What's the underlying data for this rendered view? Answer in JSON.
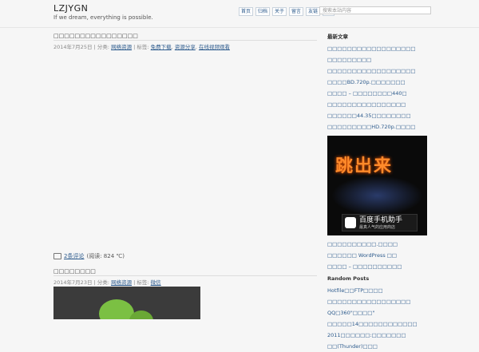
{
  "site": {
    "title": "LZJYGN",
    "tagline": "If we dream, everything is possible."
  },
  "nav": {
    "items": [
      "首页",
      "归档",
      "关于",
      "留言",
      "友链"
    ],
    "search_placeholder": "搜索本站内容"
  },
  "posts": [
    {
      "title": "□□□□□□□□□□□□□□□□",
      "date": "2014年7月25日",
      "cat_label": "分类:",
      "category": "网络资源",
      "tag_label": "标签:",
      "tags": [
        "免费下载",
        "资源分享",
        "在线视频观看"
      ],
      "comments": "2条评论",
      "views": "(阅读: 824 ℃)"
    },
    {
      "title": "□□□□□□□□",
      "date": "2014年7月23日",
      "cat_label": "分类:",
      "category": "网络资源",
      "tag_label": "标签:",
      "tags": [
        "微信"
      ]
    }
  ],
  "sidebar": {
    "recent_heading": "最新文章",
    "recent": [
      "□□□□□□□□□□□□□□□□□□",
      "□□□□□□□□□",
      "□□□□□□□□□□□□□□□□□□",
      "□□□□BD.720p.□□□□□□□",
      "□□□□ – □□□□□□□□440□",
      "□□□□□□□□□□□□□□□□",
      "□□□□□□44.35□□□□□□□□",
      "□□□□□□□□□HD.720p.□□□□"
    ],
    "ad": {
      "neon_text": "跳出来",
      "brand": "百度手机助手",
      "slogan": "最真人气的应用商店"
    },
    "below_ad": [
      "□□□□□□□□□□.□□□□",
      "□□□□□□ WordPress □□",
      "□□□□ – □□□□□□□□□□"
    ],
    "random_heading": "Random Posts",
    "random": [
      "Hotfile□□FTP□□□□",
      "□□□□□□□□□□□□□□□□□",
      "QQ□360\"□□□□\"",
      "□□□□□14□□□□□□□□□□□□",
      "2011□□□□□□:□□□□□□□",
      "□□(Thunder)□□□"
    ]
  },
  "colors": {
    "link": "#2c5a8c",
    "rss": "#f39a31"
  }
}
